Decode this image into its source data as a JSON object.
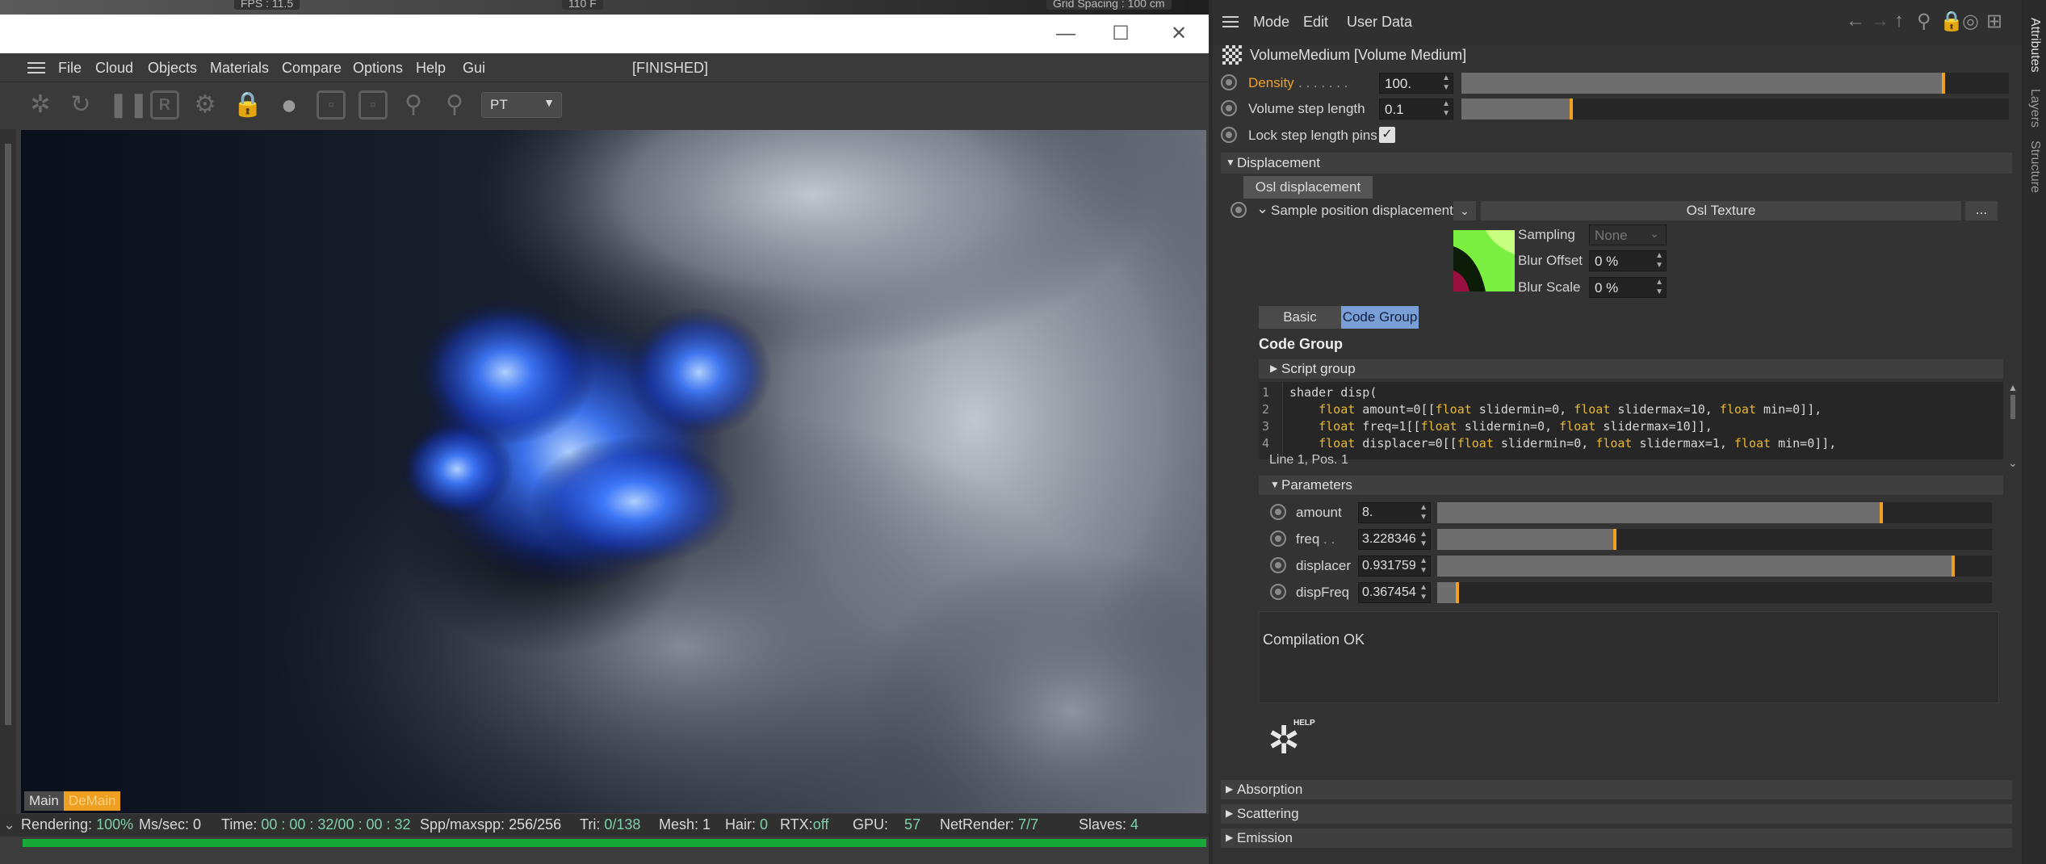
{
  "top_strip": {
    "fps": "FPS : 11.5",
    "frame": "110 F",
    "grid": "Grid Spacing : 100 cm"
  },
  "window_controls": {
    "minimize": "—",
    "maximize": "☐",
    "close": "✕"
  },
  "render_window": {
    "status_title": "[FINISHED]",
    "menu": [
      "File",
      "Cloud",
      "Objects",
      "Materials",
      "Compare",
      "Options",
      "Help",
      "Gui"
    ],
    "render_mode": "PT",
    "view_tabs": [
      "Main",
      "DeMain"
    ]
  },
  "statusbar": {
    "rendering_label": "Rendering:",
    "rendering_value": "100%",
    "ms_label": "Ms/sec:",
    "ms_value": "0",
    "time_label": "Time:",
    "time_value": "00 : 00 : 32/00 : 00 : 32",
    "spp_label": "Spp/maxspp:",
    "spp_value": "256/256",
    "tri_label": "Tri:",
    "tri_value": "0/138",
    "mesh_label": "Mesh:",
    "mesh_value": "1",
    "hair_label": "Hair:",
    "hair_value": "0",
    "rtx_label": "RTX:",
    "rtx_value": "off",
    "gpu_label": "GPU:",
    "gpu_value": "57",
    "netrender_label": "NetRender:",
    "netrender_value": "7/7",
    "slaves_label": "Slaves:",
    "slaves_value": "4",
    "progress": 1.0
  },
  "attributes": {
    "menu": [
      "Mode",
      "Edit",
      "User Data"
    ],
    "object_title": "VolumeMedium [Volume Medium]",
    "density": {
      "label": "Density",
      "value": "100.",
      "fraction": 0.88
    },
    "volume_step": {
      "label": "Volume step length",
      "value": "0.1",
      "fraction": 0.2
    },
    "lock_step": {
      "label": "Lock step length pins",
      "checked": true
    },
    "displacement_section": "Displacement",
    "osl_tab": "Osl displacement",
    "sample_position": {
      "label": "Sample position displacement",
      "texture": "Osl Texture",
      "more": "..."
    },
    "sampling": {
      "label": "Sampling",
      "value": "None"
    },
    "blur_offset": {
      "label": "Blur Offset",
      "value": "0 %"
    },
    "blur_scale": {
      "label": "Blur Scale",
      "value": "0 %"
    },
    "tabs": [
      "Basic",
      "Code Group"
    ],
    "code_group_title": "Code Group",
    "script_group": "Script group",
    "code_lines": [
      {
        "n": "1",
        "text": "shader disp("
      },
      {
        "n": "2",
        "text": "    float amount=0[[float slidermin=0, float slidermax=10, float min=0]],"
      },
      {
        "n": "3",
        "text": "    float freq=1[[float slidermin=0, float slidermax=10]],"
      },
      {
        "n": "4",
        "text": "    float displacer=0[[float slidermin=0, float slidermax=1, float min=0]],"
      }
    ],
    "cursor_pos": "Line 1, Pos. 1",
    "parameters_section": "Parameters",
    "params": [
      {
        "label": "amount",
        "dots": "",
        "value": "8.",
        "fraction": 0.8
      },
      {
        "label": "freq",
        "dots": " . .",
        "value": "3.228346",
        "fraction": 0.32
      },
      {
        "label": "displacer",
        "dots": "",
        "value": "0.931759",
        "fraction": 0.93
      },
      {
        "label": "dispFreq",
        "dots": "",
        "value": "0.367454",
        "fraction": 0.037
      }
    ],
    "compile_status": "Compilation OK",
    "help_badge": "HELP",
    "bottom_sections": [
      "Absorption",
      "Scattering",
      "Emission"
    ]
  },
  "side_tabs": [
    "Attributes",
    "Layers",
    "Structure"
  ],
  "colors": {
    "accent_orange": "#f0a020",
    "status_green": "#7dd0a8",
    "progress_green": "#18a83a",
    "tab_active": "#7a9fd6"
  }
}
